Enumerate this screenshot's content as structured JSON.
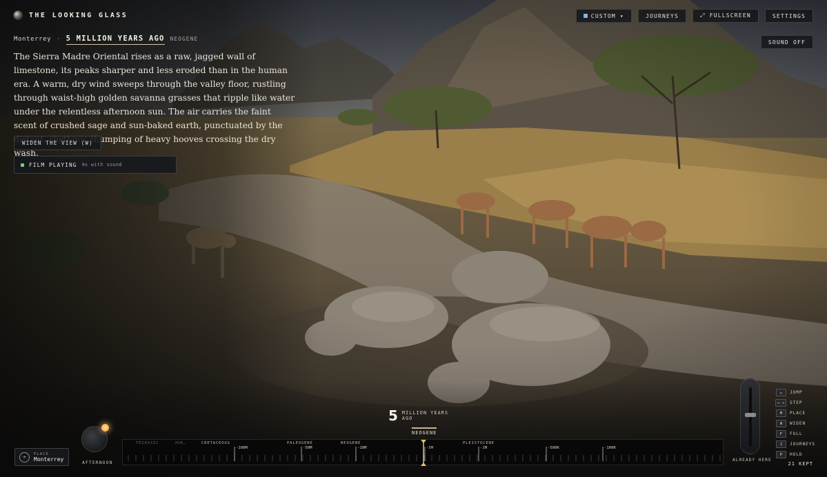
{
  "app": {
    "title": "THE LOOKING GLASS"
  },
  "toolbar": {
    "custom_label": "CUSTOM ▾",
    "journeys_label": "JOURNEYS",
    "fullscreen_label": "⤢ FULLSCREEN",
    "settings_label": "SETTINGS",
    "sound_label": "SOUND OFF"
  },
  "era": {
    "place": "Monterrey",
    "separator": "·",
    "age": "5 MILLION YEARS AGO",
    "period": "NEOGENE"
  },
  "narrative": "The Sierra Madre Oriental rises as a raw, jagged wall of limestone, its peaks sharper and less eroded than in the human era. A warm, dry wind sweeps through the valley floor, rustling through waist-high golden savanna grasses that ripple like water under the relentless afternoon sun. The air carries the faint scent of crushed sage and sun-baked earth, punctuated by the distant, rhythmic thumping of heavy hooves crossing the dry wash.",
  "actions": {
    "widen_label": "WIDEN THE VIEW (W)",
    "film_label": "FILM PLAYING",
    "film_sub": "4s with sound"
  },
  "hud": {
    "big_number": "5",
    "big_unit_line1": "MILLION YEARS",
    "big_unit_line2": "AGO",
    "era_tag": "NEOGENE"
  },
  "place_control": {
    "small": "PLACE",
    "name": "Monterrey"
  },
  "time_of_day": {
    "label": "AFTERNOON"
  },
  "timeline": {
    "periods": [
      {
        "label": "TRIASSIC",
        "dim": true
      },
      {
        "label": "JUR…",
        "dim": true
      },
      {
        "label": "CRETACEOUS",
        "dim": false
      },
      {
        "label": "PALEOGENE",
        "dim": false
      },
      {
        "label": "NEOGENE",
        "dim": false
      },
      {
        "label": "PLEISTOCENE",
        "dim": false
      }
    ],
    "ticks": [
      "-100M",
      "-50M",
      "-10M",
      "-5M",
      "-1M",
      "-500K",
      "-100K"
    ],
    "current_tick": "-5M"
  },
  "slider": {
    "label": "ALREADY HERE"
  },
  "shortcuts": [
    {
      "key": "↵",
      "label": "JUMP"
    },
    {
      "key": "← →",
      "label": "STEP"
    },
    {
      "key": "M",
      "label": "PLACE"
    },
    {
      "key": "W",
      "label": "WIDEN"
    },
    {
      "key": "F",
      "label": "FULL"
    },
    {
      "key": "J",
      "label": "JOURNEYS"
    },
    {
      "key": "P",
      "label": "HOLD"
    }
  ],
  "kept": "21 KEPT",
  "colors": {
    "accent": "#7fb6e8",
    "marker": "#e3c36b",
    "film_dot": "#6fd06a"
  }
}
